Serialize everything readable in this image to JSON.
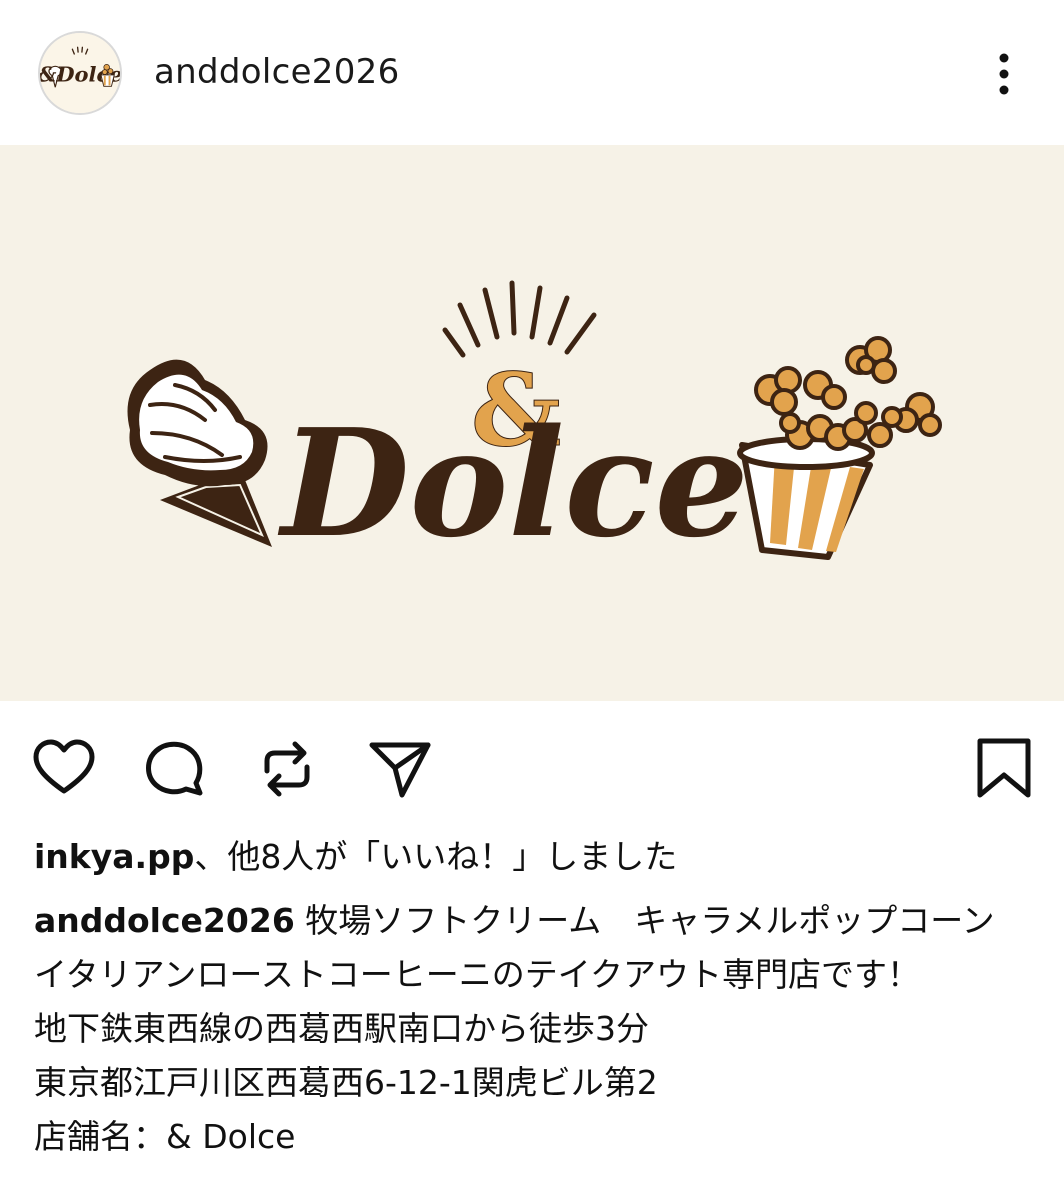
{
  "post": {
    "username": "anddolce2026",
    "avatar_logo_text": "&Dolce",
    "image": {
      "logo_amp": "&",
      "logo_word": "Dolce",
      "colors": {
        "background": "#f6f2e7",
        "brown": "#3d2413",
        "caramel": "#e2a34d",
        "cream": "#ffffff"
      }
    },
    "icons": {
      "more": "more-vertical-icon",
      "like": "heart-icon",
      "comment": "comment-bubble-icon",
      "repost": "repost-icon",
      "share": "send-icon",
      "save": "bookmark-icon"
    },
    "likes": {
      "user": "inkya.pp",
      "text": "、他8人が「いいね！」しました"
    },
    "caption": {
      "username": "anddolce2026",
      "first": " 牧場ソフトクリーム　キャラメルポップコーン　イタリアンローストコーヒーニのテイクアウト専門店です！",
      "line2": "地下鉄東西線の西葛西駅南口から徒歩3分",
      "line3": "東京都江戸川区西葛西6-12-1関虎ビル第2",
      "line4": "店舗名：& Dolce"
    }
  }
}
